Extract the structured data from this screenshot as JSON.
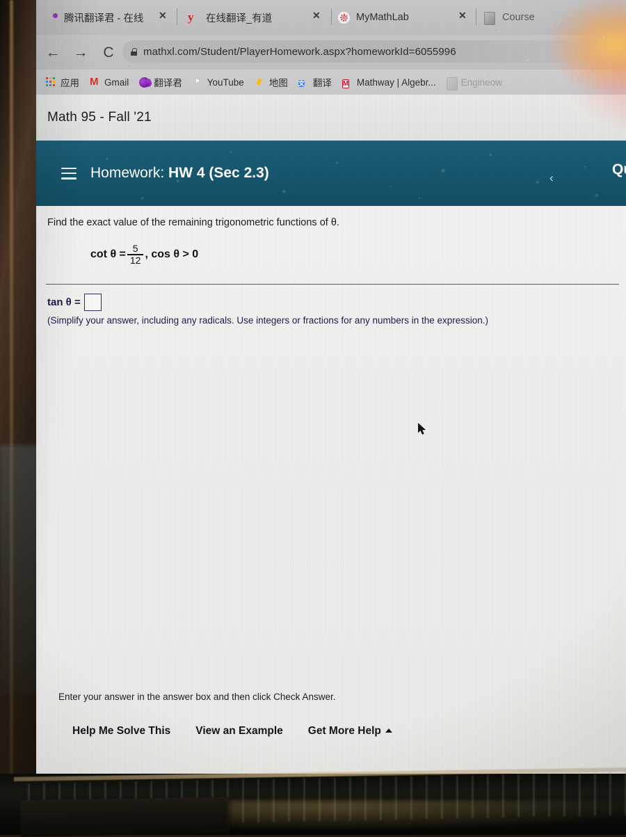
{
  "browser": {
    "tabs": [
      {
        "title": "腾讯翻译君 - 在线",
        "icon": "qq-translate-favicon",
        "has_close": true
      },
      {
        "title": "在线翻译_有道",
        "icon": "youdao-favicon",
        "has_close": true
      },
      {
        "title": "MyMathLab",
        "icon": "mymathlab-favicon",
        "has_close": true
      },
      {
        "title": "Course",
        "icon": "document-favicon",
        "has_close": false
      }
    ],
    "nav": {
      "back": "←",
      "forward": "→",
      "reload": "C"
    },
    "url": "mathxl.com/Student/PlayerHomework.aspx?homeworkId=6055996",
    "lock_icon": "lock-icon",
    "bookmarks": [
      {
        "label": "应用",
        "icon": "apps-grid-icon"
      },
      {
        "label": "Gmail",
        "icon": "gmail-icon"
      },
      {
        "label": "翻译君",
        "icon": "qq-translate-icon"
      },
      {
        "label": "YouTube",
        "icon": "youtube-icon"
      },
      {
        "label": "地图",
        "icon": "google-maps-icon"
      },
      {
        "label": "翻译",
        "icon": "google-translate-icon"
      },
      {
        "label": "Mathway | Algebr...",
        "icon": "mathway-icon"
      },
      {
        "label": "Engineow",
        "icon": "faded-bookmark-icon"
      }
    ]
  },
  "course": {
    "title": "Math 95 - Fall '21"
  },
  "homework_header": {
    "menu_icon": "hamburger-menu-icon",
    "label": "Homework:",
    "assignment": "HW 4 (Sec 2.3)",
    "prev_icon": "chevron-left-icon",
    "question_label": "Ques"
  },
  "question": {
    "prompt": "Find the exact value of the remaining trigonometric functions of θ.",
    "given": {
      "function": "cot θ =",
      "numerator": "5",
      "denominator": "12",
      "condition": ", cos θ > 0"
    },
    "answer_label": "tan θ =",
    "answer_value": "",
    "instruction": "(Simplify your answer, including any radicals. Use integers or fractions for any numbers in the expression.)"
  },
  "footer": {
    "enter_note": "Enter your answer in the answer box and then click Check Answer.",
    "actions": [
      {
        "label": "Help Me Solve This",
        "caret": false
      },
      {
        "label": "View an Example",
        "caret": false
      },
      {
        "label": "Get More Help",
        "caret": true
      }
    ]
  },
  "colors": {
    "header_teal": "#17576f",
    "answer_navy": "#1b1b46",
    "sheet_bg": "#ededeb",
    "chrome_gray": "#c2c2c4"
  }
}
